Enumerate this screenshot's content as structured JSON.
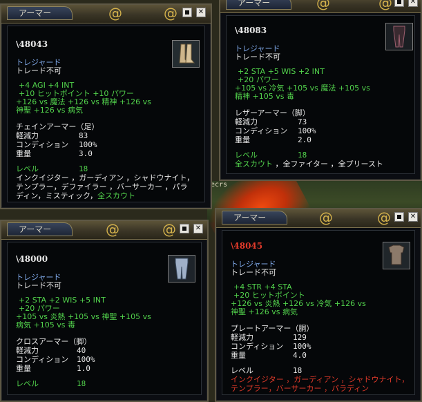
{
  "windows": [
    {
      "title": "アーマー",
      "item_id": "\\48043",
      "item_id_color": "#e8e8e8",
      "type_line": "トレジャード",
      "trade_line": "トレード不可",
      "stats": [
        "+4 AGI +4 INT",
        "+10 ヒットポイント +10 パワー",
        "+126 vs 魔法 +126 vs 精神 +126 vs",
        "神聖 +126 vs 病気"
      ],
      "armor_type": "チェインアーマー（足）",
      "mitigation_label": "軽減力",
      "mitigation": "83",
      "condition_label": "コンディション",
      "condition": "100%",
      "weight_label": "重量",
      "weight": "3.0",
      "level_label": "レベル",
      "level": "18",
      "classes": [
        "インクイジター ，ガーディアン ，シャドウナイト，",
        "テンプラー，デファイラー ，バーサーカー ，パラ",
        "ディン，ミスティック，"
      ],
      "classes_tail": "全スカウト",
      "icon": "chain-boots-icon"
    },
    {
      "title": "アーマー",
      "item_id": "\\48083",
      "item_id_color": "#e8e8e8",
      "type_line": "トレジャード",
      "trade_line": "トレード不可",
      "stats": [
        "+2 STA +5 WIS +2 INT",
        "+20 パワー",
        "+105 vs 冷気 +105 vs 魔法 +105 vs",
        "精神 +105 vs 毒"
      ],
      "armor_type": "レザーアーマー（脚）",
      "mitigation_label": "軽減力",
      "mitigation": "73",
      "condition_label": "コンディション",
      "condition": "100%",
      "weight_label": "重量",
      "weight": "2.0",
      "level_label": "レベル",
      "level": "18",
      "classes_green": "全スカウト",
      "classes_white": " ，全ファイター ，全プリースト",
      "icon": "leather-leggings-icon"
    },
    {
      "title": "アーマー",
      "item_id": "\\48000",
      "item_id_color": "#e8e8e8",
      "type_line": "トレジャード",
      "trade_line": "トレード不可",
      "stats": [
        "+2 STA +2 WIS +5 INT",
        "+20 パワー",
        "+105 vs 炎熱 +105 vs 神聖 +105 vs",
        "病気 +105 vs 毒"
      ],
      "armor_type": "クロスアーマー（脚）",
      "mitigation_label": "軽減力",
      "mitigation": "40",
      "condition_label": "コンディション",
      "condition": "100%",
      "weight_label": "重量",
      "weight": "1.0",
      "level_label": "レベル",
      "level": "18",
      "icon": "cloth-pants-icon"
    },
    {
      "title": "アーマー",
      "item_id": "\\48045",
      "item_id_color": "#e03a2a",
      "type_line": "トレジャード",
      "trade_line": "トレード不可",
      "stats": [
        "+4 STR +4 STA",
        "+20 ヒットポイント",
        "+126 vs 炎熱 +126 vs 冷気 +126 vs",
        "神聖 +126 vs 病気"
      ],
      "armor_type": "プレートアーマー（胴）",
      "mitigation_label": "軽減力",
      "mitigation": "129",
      "condition_label": "コンディション",
      "condition": "100%",
      "weight_label": "重量",
      "weight": "4.0",
      "level_label": "レベル",
      "level": "18",
      "classes": [
        "インクイジター ，ガーディアン ，シャドウナイト，",
        "テンプラー，バーサーカー ，パラディン"
      ],
      "icon": "plate-chest-icon"
    }
  ],
  "background_text": "ecrs",
  "colors": {
    "green": "#52d24c",
    "blue": "#7fa8e8",
    "red": "#e03a2a",
    "white": "#e8e8e8"
  }
}
